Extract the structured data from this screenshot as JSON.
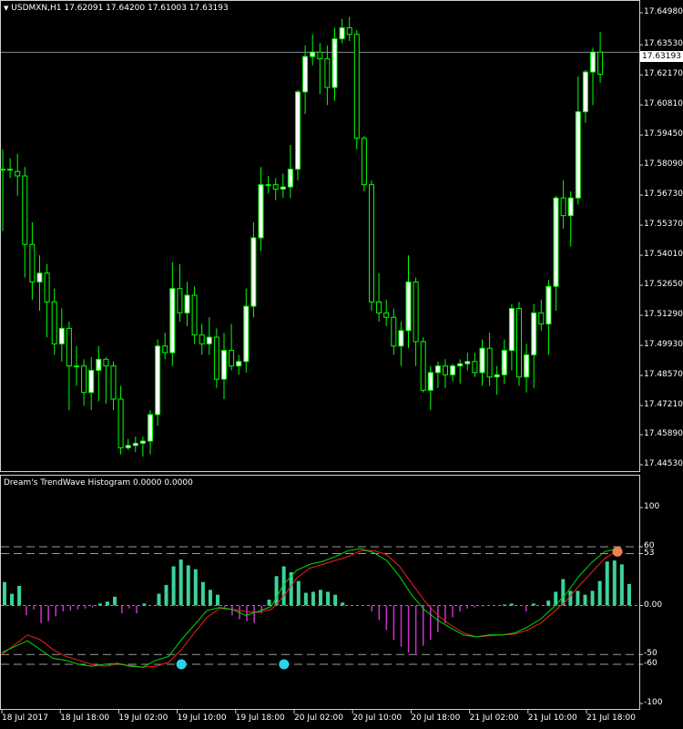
{
  "main_chart": {
    "symbol_label": "USDMXN,H1  17.62091 17.64200 17.61003 17.63193",
    "price_axis_labels": [
      "17.64980",
      "17.63530",
      "17.62170",
      "17.60810",
      "17.59450",
      "17.58090",
      "17.56730",
      "17.55370",
      "17.54010",
      "17.52650",
      "17.51290",
      "17.49930",
      "17.48570",
      "17.47210",
      "17.45890",
      "17.44530"
    ],
    "current_price_label": "17.63193",
    "current_price": 17.63193,
    "ylim": [
      17.4453,
      17.6498
    ]
  },
  "indicator": {
    "title": "Dream's TrendWave Histogram 0.0000 0.0000",
    "axis_labels": [
      "100",
      "60",
      "53",
      "0.00",
      "-50",
      "-60",
      "-100"
    ],
    "ylim": [
      -100,
      100
    ],
    "levels": [
      60,
      53,
      -50,
      -60
    ]
  },
  "time_axis_labels": [
    "18 Jul 2017",
    "18 Jul 18:00",
    "19 Jul 02:00",
    "19 Jul 10:00",
    "19 Jul 18:00",
    "20 Jul 02:00",
    "20 Jul 10:00",
    "20 Jul 18:00",
    "21 Jul 02:00",
    "21 Jul 10:00",
    "21 Jul 18:00"
  ],
  "colors": {
    "bull_candle": "#ffffff",
    "bear_candle": "#000000",
    "candle_outline": "#00ff00",
    "hist_positive": "#3cd29a",
    "hist_negative": "#cc33cc",
    "signal_green": "#00dd00",
    "signal_red": "#ee2222",
    "dot_buy": "#29d5ea",
    "dot_sell": "#f0805a",
    "price_line": "#7f8b99"
  },
  "chart_data": [
    {
      "type": "candlestick",
      "candles": [
        [
          17.579,
          17.588,
          17.551,
          17.579
        ],
        [
          17.579,
          17.584,
          17.575,
          17.579
        ],
        [
          17.578,
          17.586,
          17.567,
          17.576
        ],
        [
          17.576,
          17.58,
          17.53,
          17.545
        ],
        [
          17.545,
          17.555,
          17.52,
          17.528
        ],
        [
          17.528,
          17.54,
          17.515,
          17.532
        ],
        [
          17.532,
          17.536,
          17.503,
          17.519
        ],
        [
          17.519,
          17.525,
          17.495,
          17.5
        ],
        [
          17.5,
          17.516,
          17.492,
          17.507
        ],
        [
          17.507,
          17.51,
          17.47,
          17.49
        ],
        [
          17.49,
          17.499,
          17.481,
          17.49
        ],
        [
          17.49,
          17.493,
          17.472,
          17.478
        ],
        [
          17.478,
          17.494,
          17.47,
          17.488
        ],
        [
          17.488,
          17.499,
          17.474,
          17.493
        ],
        [
          17.493,
          17.494,
          17.473,
          17.49
        ],
        [
          17.49,
          17.492,
          17.47,
          17.475
        ],
        [
          17.475,
          17.481,
          17.45,
          17.453
        ],
        [
          17.453,
          17.457,
          17.452,
          17.454
        ],
        [
          17.454,
          17.458,
          17.451,
          17.455
        ],
        [
          17.455,
          17.458,
          17.449,
          17.456
        ],
        [
          17.456,
          17.47,
          17.45,
          17.468
        ],
        [
          17.468,
          17.502,
          17.463,
          17.499
        ],
        [
          17.499,
          17.505,
          17.493,
          17.496
        ],
        [
          17.496,
          17.537,
          17.49,
          17.525
        ],
        [
          17.525,
          17.536,
          17.51,
          17.514
        ],
        [
          17.514,
          17.528,
          17.508,
          17.522
        ],
        [
          17.522,
          17.526,
          17.5,
          17.504
        ],
        [
          17.504,
          17.509,
          17.495,
          17.5
        ],
        [
          17.5,
          17.512,
          17.495,
          17.503
        ],
        [
          17.503,
          17.507,
          17.48,
          17.484
        ],
        [
          17.484,
          17.505,
          17.475,
          17.497
        ],
        [
          17.497,
          17.509,
          17.488,
          17.49
        ],
        [
          17.49,
          17.495,
          17.486,
          17.492
        ],
        [
          17.492,
          17.525,
          17.487,
          17.517
        ],
        [
          17.517,
          17.555,
          17.512,
          17.548
        ],
        [
          17.548,
          17.58,
          17.542,
          17.572
        ],
        [
          17.572,
          17.576,
          17.568,
          17.572
        ],
        [
          17.572,
          17.575,
          17.565,
          17.57
        ],
        [
          17.57,
          17.577,
          17.566,
          17.571
        ],
        [
          17.571,
          17.59,
          17.566,
          17.579
        ],
        [
          17.579,
          17.615,
          17.574,
          17.614
        ],
        [
          17.614,
          17.635,
          17.604,
          17.63
        ],
        [
          17.63,
          17.64,
          17.626,
          17.632
        ],
        [
          17.632,
          17.636,
          17.613,
          17.629
        ],
        [
          17.629,
          17.635,
          17.608,
          17.616
        ],
        [
          17.616,
          17.643,
          17.61,
          17.638
        ],
        [
          17.638,
          17.647,
          17.636,
          17.643
        ],
        [
          17.643,
          17.648,
          17.637,
          17.64
        ],
        [
          17.64,
          17.642,
          17.588,
          17.593
        ],
        [
          17.593,
          17.594,
          17.569,
          17.572
        ],
        [
          17.572,
          17.574,
          17.515,
          17.519
        ],
        [
          17.519,
          17.532,
          17.51,
          17.514
        ],
        [
          17.514,
          17.52,
          17.508,
          17.512
        ],
        [
          17.512,
          17.516,
          17.495,
          17.499
        ],
        [
          17.499,
          17.51,
          17.49,
          17.506
        ],
        [
          17.506,
          17.54,
          17.498,
          17.528
        ],
        [
          17.528,
          17.53,
          17.49,
          17.501
        ],
        [
          17.501,
          17.503,
          17.478,
          17.479
        ],
        [
          17.479,
          17.49,
          17.47,
          17.487
        ],
        [
          17.487,
          17.492,
          17.48,
          17.49
        ],
        [
          17.49,
          17.493,
          17.48,
          17.486
        ],
        [
          17.486,
          17.491,
          17.483,
          17.49
        ],
        [
          17.49,
          17.493,
          17.482,
          17.491
        ],
        [
          17.491,
          17.496,
          17.488,
          17.492
        ],
        [
          17.492,
          17.496,
          17.485,
          17.487
        ],
        [
          17.487,
          17.502,
          17.481,
          17.498
        ],
        [
          17.498,
          17.505,
          17.481,
          17.485
        ],
        [
          17.485,
          17.49,
          17.477,
          17.486
        ],
        [
          17.486,
          17.502,
          17.482,
          17.497
        ],
        [
          17.497,
          17.518,
          17.488,
          17.516
        ],
        [
          17.516,
          17.519,
          17.481,
          17.485
        ],
        [
          17.485,
          17.5,
          17.478,
          17.495
        ],
        [
          17.495,
          17.518,
          17.48,
          17.514
        ],
        [
          17.514,
          17.52,
          17.506,
          17.509
        ],
        [
          17.509,
          17.529,
          17.495,
          17.526
        ],
        [
          17.526,
          17.567,
          17.515,
          17.566
        ],
        [
          17.566,
          17.574,
          17.552,
          17.558
        ],
        [
          17.558,
          17.569,
          17.544,
          17.566
        ],
        [
          17.566,
          17.621,
          17.563,
          17.605
        ],
        [
          17.605,
          17.624,
          17.6,
          17.623
        ],
        [
          17.623,
          17.634,
          17.608,
          17.632
        ],
        [
          17.632,
          17.641,
          17.618,
          17.622
        ]
      ]
    },
    {
      "type": "histogram",
      "hist": [
        24,
        12,
        20,
        -10,
        -4,
        -18,
        -16,
        -11,
        -6,
        -5,
        -4,
        -3,
        -2,
        2,
        4,
        9,
        -8,
        -3,
        -8,
        2,
        0,
        12,
        21,
        40,
        47,
        41,
        37,
        24,
        16,
        11,
        -2,
        -10,
        -14,
        -16,
        -18,
        -8,
        6,
        30,
        40,
        34,
        25,
        13,
        14,
        16,
        14,
        11,
        3,
        0,
        0,
        0,
        -6,
        -15,
        -25,
        -35,
        -42,
        -48,
        -50,
        -41,
        -35,
        -27,
        -18,
        -12,
        -6,
        -3,
        -2,
        -1,
        0,
        0,
        1,
        2,
        0,
        -6,
        2,
        0,
        5,
        14,
        27,
        15,
        15,
        11,
        15,
        25,
        45,
        46,
        42,
        22
      ],
      "green_line": [
        -48,
        -42,
        -36,
        -45,
        -54,
        -56,
        -60,
        -62,
        -60,
        -59,
        -62,
        -63,
        -56,
        -52,
        -35,
        -20,
        -5,
        -2,
        -4,
        -10,
        -6,
        -1,
        22,
        36,
        42,
        45,
        50,
        56,
        58,
        54,
        46,
        30,
        10,
        -5,
        -15,
        -23,
        -30,
        -32,
        -30,
        -30,
        -28,
        -22,
        -14,
        -2,
        12,
        30,
        44,
        55,
        58
      ],
      "red_line": [
        -50,
        -40,
        -30,
        -35,
        -45,
        -52,
        -56,
        -60,
        -62,
        -60,
        -61,
        -63,
        -62,
        -58,
        -45,
        -28,
        -12,
        -3,
        -4,
        -6,
        -7,
        -4,
        10,
        28,
        38,
        42,
        46,
        50,
        56,
        56,
        52,
        40,
        22,
        4,
        -10,
        -20,
        -28,
        -32,
        -31,
        -30,
        -29,
        -25,
        -18,
        -7,
        5,
        20,
        34,
        48,
        56
      ],
      "dots": [
        {
          "index": 14,
          "value": -60,
          "kind": "buy"
        },
        {
          "index": 22,
          "value": -60,
          "kind": "buy"
        },
        {
          "index": 48,
          "value": 55,
          "kind": "sell"
        }
      ]
    }
  ]
}
